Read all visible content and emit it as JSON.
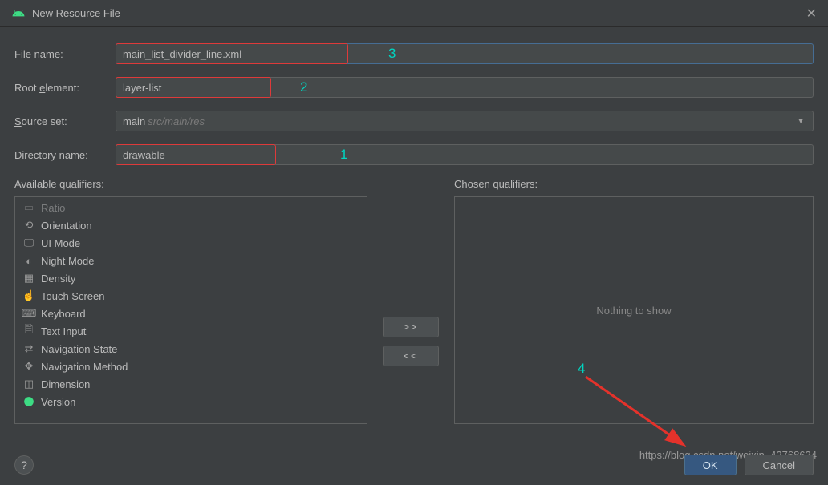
{
  "window": {
    "title": "New Resource File"
  },
  "form": {
    "filename_label": "File name:",
    "filename_value": "main_list_divider_line.xml",
    "root_label": "Root element:",
    "root_value": "layer-list",
    "source_label": "Source set:",
    "source_value": "main",
    "source_hint": "src/main/res",
    "dirname_label": "Directory name:",
    "dirname_value": "drawable"
  },
  "annotations": {
    "a1": "1",
    "a2": "2",
    "a3": "3",
    "a4": "4"
  },
  "qualifiers": {
    "available_label": "Available qualifiers:",
    "chosen_label": "Chosen qualifiers:",
    "nothing": "Nothing to show",
    "items": [
      "Ratio",
      "Orientation",
      "UI Mode",
      "Night Mode",
      "Density",
      "Touch Screen",
      "Keyboard",
      "Text Input",
      "Navigation State",
      "Navigation Method",
      "Dimension",
      "Version"
    ]
  },
  "buttons": {
    "add": ">>",
    "remove": "<<",
    "ok": "OK",
    "cancel": "Cancel",
    "help": "?"
  },
  "watermark": "https://blog.csdn.net/weixin_42768634"
}
